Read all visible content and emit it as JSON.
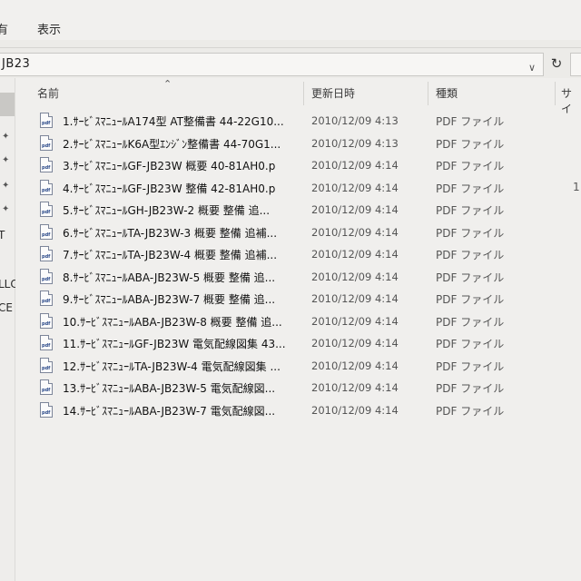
{
  "menu": {
    "partial": "有",
    "view": "表示"
  },
  "address": {
    "path": "JB23"
  },
  "sidebar": {
    "labels": [
      "T",
      "LLC",
      "CE J"
    ]
  },
  "columns": {
    "name": "名前",
    "modified": "更新日時",
    "type": "種類",
    "size": "サイ"
  },
  "files": [
    {
      "name": "1.ｻｰﾋﾞｽﾏﾆｭｰﾙA174型 AT整備書 44-22G10...",
      "date": "2010/12/09 4:13",
      "type": "PDF ファイル",
      "size": ""
    },
    {
      "name": "2.ｻｰﾋﾞｽﾏﾆｭｰﾙK6A型ｴﾝｼﾞﾝ整備書 44-70G1...",
      "date": "2010/12/09 4:13",
      "type": "PDF ファイル",
      "size": ""
    },
    {
      "name": "3.ｻｰﾋﾞｽﾏﾆｭｰﾙGF-JB23W 概要 40-81AH0.p",
      "date": "2010/12/09 4:14",
      "type": "PDF ファイル",
      "size": ""
    },
    {
      "name": "4.ｻｰﾋﾞｽﾏﾆｭｰﾙGF-JB23W 整備 42-81AH0.p",
      "date": "2010/12/09 4:14",
      "type": "PDF ファイル",
      "size": "1"
    },
    {
      "name": "5.ｻｰﾋﾞｽﾏﾆｭｰﾙGH-JB23W-2 概要 整備 追...",
      "date": "2010/12/09 4:14",
      "type": "PDF ファイル",
      "size": ""
    },
    {
      "name": "6.ｻｰﾋﾞｽﾏﾆｭｰﾙTA-JB23W-3 概要 整備 追補...",
      "date": "2010/12/09 4:14",
      "type": "PDF ファイル",
      "size": ""
    },
    {
      "name": "7.ｻｰﾋﾞｽﾏﾆｭｰﾙTA-JB23W-4 概要 整備 追補...",
      "date": "2010/12/09 4:14",
      "type": "PDF ファイル",
      "size": ""
    },
    {
      "name": "8.ｻｰﾋﾞｽﾏﾆｭｰﾙABA-JB23W-5 概要 整備 追...",
      "date": "2010/12/09 4:14",
      "type": "PDF ファイル",
      "size": ""
    },
    {
      "name": "9.ｻｰﾋﾞｽﾏﾆｭｰﾙABA-JB23W-7 概要 整備 追...",
      "date": "2010/12/09 4:14",
      "type": "PDF ファイル",
      "size": ""
    },
    {
      "name": "10.ｻｰﾋﾞｽﾏﾆｭｰﾙABA-JB23W-8 概要 整備 追...",
      "date": "2010/12/09 4:14",
      "type": "PDF ファイル",
      "size": ""
    },
    {
      "name": "11.ｻｰﾋﾞｽﾏﾆｭｰﾙGF-JB23W 電気配線図集 43...",
      "date": "2010/12/09 4:14",
      "type": "PDF ファイル",
      "size": ""
    },
    {
      "name": "12.ｻｰﾋﾞｽﾏﾆｭｰﾙTA-JB23W-4 電気配線図集 ...",
      "date": "2010/12/09 4:14",
      "type": "PDF ファイル",
      "size": ""
    },
    {
      "name": "13.ｻｰﾋﾞｽﾏﾆｭｰﾙABA-JB23W-5 電気配線図...",
      "date": "2010/12/09 4:14",
      "type": "PDF ファイル",
      "size": ""
    },
    {
      "name": "14.ｻｰﾋﾞｽﾏﾆｭｰﾙABA-JB23W-7 電気配線図...",
      "date": "2010/12/09 4:14",
      "type": "PDF ファイル",
      "size": ""
    }
  ]
}
